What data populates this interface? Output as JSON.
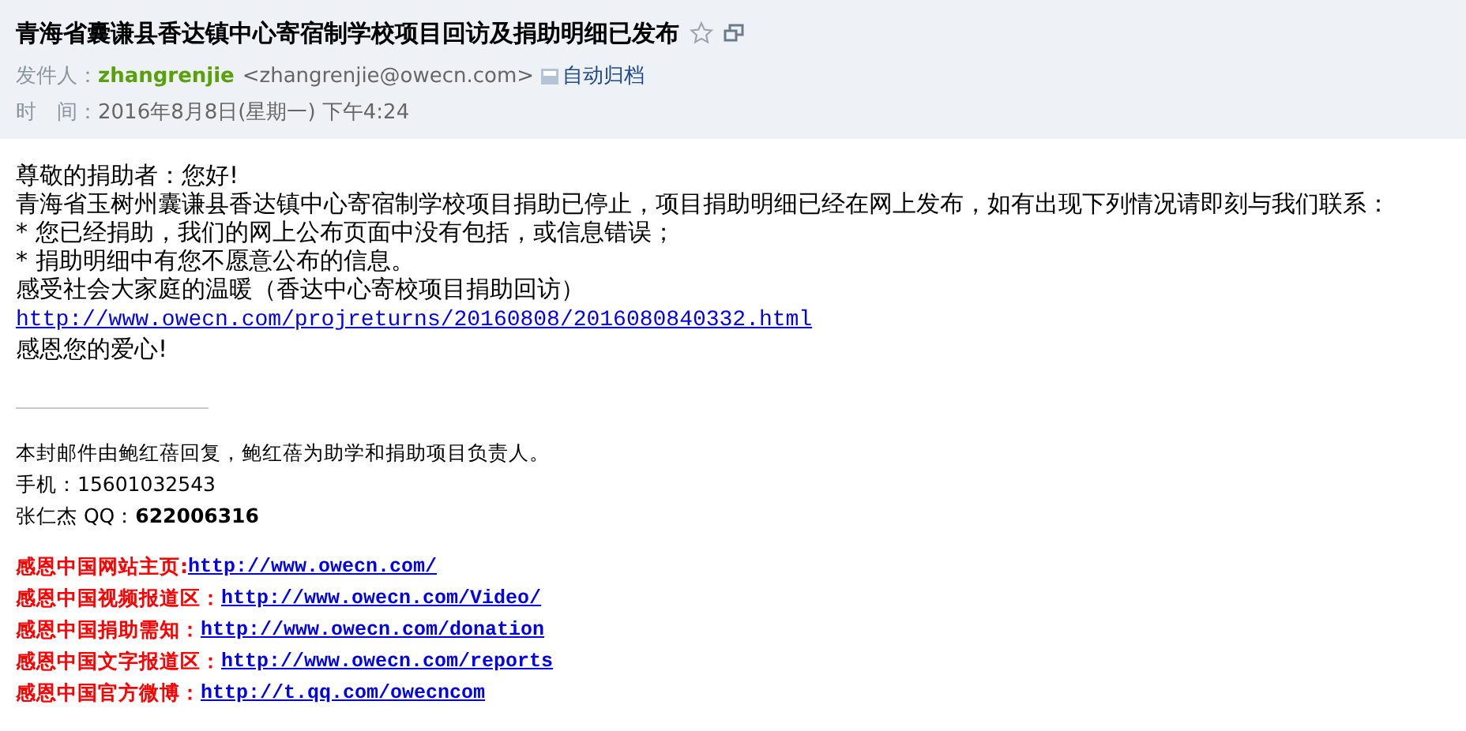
{
  "header": {
    "subject": "青海省囊谦县香达镇中心寄宿制学校项目回访及捐助明细已发布",
    "starred": false,
    "from_label": "发件人：",
    "sender_name": "zhangrenjie",
    "sender_email": "<zhangrenjie@owecn.com>",
    "archive_label": "自动归档",
    "time_label": "时　间：",
    "time": "2016年8月8日(星期一) 下午4:24"
  },
  "body": {
    "lines": [
      {
        "kind": "text",
        "text": "尊敬的捐助者：您好!"
      },
      {
        "kind": "text",
        "text": "青海省玉树州囊谦县香达镇中心寄宿制学校项目捐助已停止，项目捐助明细已经在网上发布，如有出现下列情况请即刻与我们联系："
      },
      {
        "kind": "text",
        "text": "* 您已经捐助，我们的网上公布页面中没有包括，或信息错误；"
      },
      {
        "kind": "text",
        "text": "* 捐助明细中有您不愿意公布的信息。"
      },
      {
        "kind": "text",
        "text": "感受社会大家庭的温暖（香达中心寄校项目捐助回访）"
      },
      {
        "kind": "link",
        "text": "http://www.owecn.com/projreturns/20160808/2016080840332.html"
      },
      {
        "kind": "text",
        "text": "感恩您的爱心!"
      }
    ]
  },
  "signature": {
    "lines": [
      "本封邮件由鲍红蓓回复，鲍红蓓为助学和捐助项目负责人。",
      "手机：15601032543",
      "张仁杰  QQ：**622006316**"
    ],
    "links": [
      {
        "label": "感恩中国网站主页:",
        "url": "http://www.owecn.com/"
      },
      {
        "label": "感恩中国视频报道区：",
        "url": "http://www.owecn.com/Video/"
      },
      {
        "label": "感恩中国捐助需知：",
        "url": "http://www.owecn.com/donation"
      },
      {
        "label": "感恩中国文字报道区：",
        "url": "http://www.owecn.com/reports"
      },
      {
        "label": "感恩中国官方微博：",
        "url": "http://t.qq.com/owecncom"
      }
    ]
  }
}
